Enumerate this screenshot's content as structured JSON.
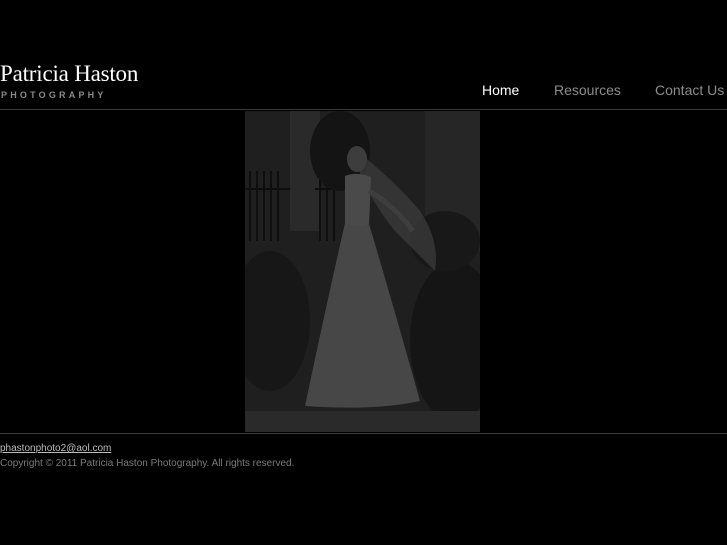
{
  "header": {
    "brand_name": "Patricia Haston",
    "brand_tagline": "PHOTOGRAPHY"
  },
  "nav": {
    "items": [
      {
        "label": "Home",
        "active": true
      },
      {
        "label": "Resources",
        "active": false
      },
      {
        "label": "Contact Us",
        "active": false
      }
    ]
  },
  "main": {
    "photo_description": "bride-in-gown-photo"
  },
  "footer": {
    "email": "phastonphoto2@aol.com",
    "copyright": "Copyright © 2011 Patricia Haston Photography. All rights reserved."
  },
  "colors": {
    "background": "#000000",
    "nav_active": "#ffffff",
    "nav_inactive": "#8c8c8c",
    "divider": "#3a3a3a"
  }
}
